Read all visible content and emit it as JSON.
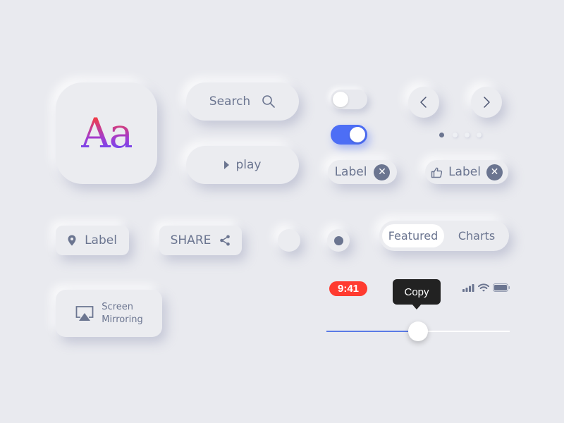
{
  "app_icon": {
    "glyph": "Aa",
    "gradient_colors": [
      "#ff3d2e",
      "#a23cd0",
      "#5b4cff"
    ]
  },
  "search_button": {
    "label": "Search",
    "icon": "search-icon"
  },
  "play_button": {
    "label": "play",
    "icon": "play-icon"
  },
  "toggles": [
    {
      "state": "off"
    },
    {
      "state": "on",
      "color": "#4d6ef5"
    }
  ],
  "pager": {
    "prev_icon": "chevron-left-icon",
    "next_icon": "chevron-right-icon",
    "dots_total": 4,
    "active_index": 0
  },
  "chips": [
    {
      "label": "Label",
      "icon": null,
      "close_glyph": "✕"
    },
    {
      "label": "Label",
      "icon": "thumbs-up-icon",
      "close_glyph": "✕"
    }
  ],
  "location_label": {
    "label": "Label",
    "icon": "location-pin-icon"
  },
  "share_button": {
    "label": "SHARE",
    "icon": "share-icon"
  },
  "radios": [
    {
      "selected": false
    },
    {
      "selected": true
    }
  ],
  "segmented_control": {
    "options": [
      "Featured",
      "Charts"
    ],
    "selected": "Featured"
  },
  "screen_mirroring": {
    "line1": "Screen",
    "line2": "Mirroring",
    "icon": "airplay-icon"
  },
  "status_bar": {
    "time": "9:41",
    "time_color": "#ff3b30",
    "icons": [
      "signal-icon",
      "wifi-icon",
      "battery-icon"
    ]
  },
  "tooltip": {
    "label": "Copy"
  },
  "slider": {
    "value_fraction": 0.5,
    "fill_color": "#5b7ae6"
  },
  "colors": {
    "background": "#e9eaef",
    "text": "#6b7590",
    "accent": "#4d6ef5"
  }
}
